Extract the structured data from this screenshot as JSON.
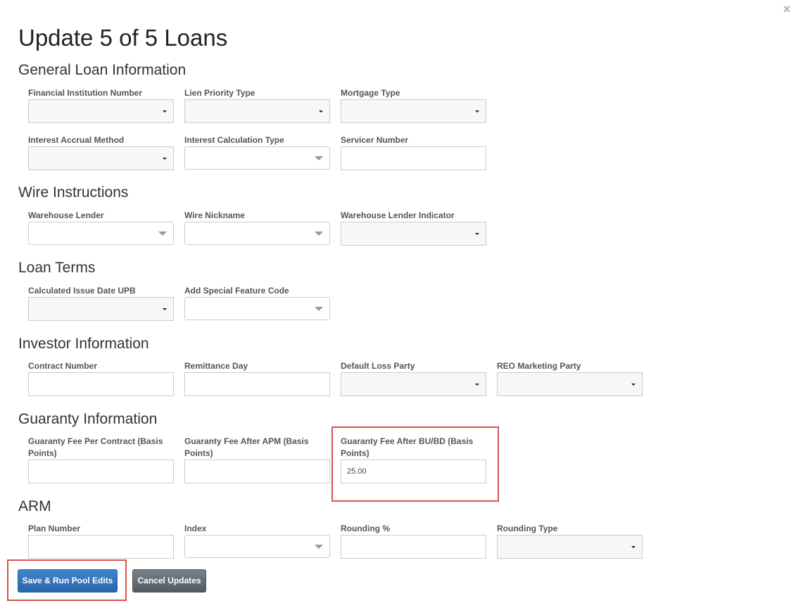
{
  "dialog": {
    "title": "Update 5 of 5 Loans",
    "close_label": "×"
  },
  "sections": {
    "general": {
      "title": "General Loan Information",
      "fields": {
        "financial_institution_number": {
          "label": "Financial Institution Number",
          "value": ""
        },
        "lien_priority_type": {
          "label": "Lien Priority Type",
          "value": ""
        },
        "mortgage_type": {
          "label": "Mortgage Type",
          "value": ""
        },
        "interest_accrual_method": {
          "label": "Interest Accrual Method",
          "value": ""
        },
        "interest_calculation_type": {
          "label": "Interest Calculation Type",
          "value": ""
        },
        "servicer_number": {
          "label": "Servicer Number",
          "value": ""
        }
      }
    },
    "wire": {
      "title": "Wire Instructions",
      "fields": {
        "warehouse_lender": {
          "label": "Warehouse Lender",
          "value": ""
        },
        "wire_nickname": {
          "label": "Wire Nickname",
          "value": ""
        },
        "warehouse_lender_indicator": {
          "label": "Warehouse Lender Indicator",
          "value": ""
        }
      }
    },
    "loan_terms": {
      "title": "Loan Terms",
      "fields": {
        "calculated_issue_date_upb": {
          "label": "Calculated Issue Date UPB",
          "value": ""
        },
        "add_special_feature_code": {
          "label": "Add Special Feature Code",
          "value": ""
        }
      }
    },
    "investor": {
      "title": "Investor Information",
      "fields": {
        "contract_number": {
          "label": "Contract Number",
          "value": ""
        },
        "remittance_day": {
          "label": "Remittance Day",
          "value": ""
        },
        "default_loss_party": {
          "label": "Default Loss Party",
          "value": ""
        },
        "reo_marketing_party": {
          "label": "REO Marketing Party",
          "value": ""
        }
      }
    },
    "guaranty": {
      "title": "Guaranty Information",
      "fields": {
        "fee_per_contract": {
          "label": "Guaranty Fee Per Contract (Basis Points)",
          "value": ""
        },
        "fee_after_apm": {
          "label": "Guaranty Fee After APM (Basis Points)",
          "value": ""
        },
        "fee_after_bubd": {
          "label": "Guaranty Fee After BU/BD (Basis Points)",
          "value": "25.00"
        }
      }
    },
    "arm": {
      "title": "ARM",
      "fields": {
        "plan_number": {
          "label": "Plan Number",
          "value": ""
        },
        "index": {
          "label": "Index",
          "value": ""
        },
        "rounding_pct": {
          "label": "Rounding %",
          "value": ""
        },
        "rounding_type": {
          "label": "Rounding Type",
          "value": ""
        }
      }
    }
  },
  "buttons": {
    "save": "Save & Run Pool Edits",
    "cancel": "Cancel Updates"
  },
  "highlight_color": "#d9534f",
  "primary_color": "#2f6fb8",
  "secondary_color": "#5f676e"
}
